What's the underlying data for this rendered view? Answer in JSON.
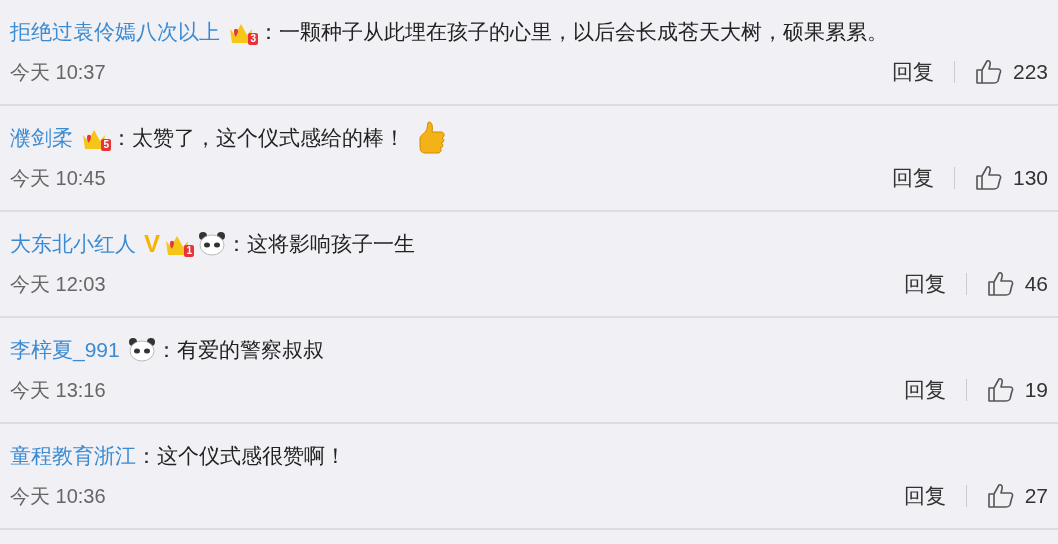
{
  "comments": [
    {
      "user": "拒绝过袁伶嫣八次以上",
      "badges": [
        {
          "kind": "crown",
          "label": "3"
        }
      ],
      "text": "：一颗种子从此埋在孩子的心里，以后会长成苍天大树，硕果累累。",
      "time": "今天 10:37",
      "reply": "回复",
      "likes": "223"
    },
    {
      "user": "濮剑柔",
      "badges": [
        {
          "kind": "crown",
          "label": "5"
        }
      ],
      "text": "：太赞了，这个仪式感给的棒！",
      "emoji": {
        "kind": "thumbs-up"
      },
      "time": "今天 10:45",
      "reply": "回复",
      "likes": "130"
    },
    {
      "user": "大东北小红人",
      "badges": [
        {
          "kind": "verified",
          "label": "V"
        },
        {
          "kind": "crown",
          "label": "1"
        },
        {
          "kind": "panda"
        }
      ],
      "text": "：这将影响孩子一生",
      "time": "今天 12:03",
      "reply": "回复",
      "likes": "46"
    },
    {
      "user": "李梓夏_991",
      "badges": [
        {
          "kind": "panda"
        }
      ],
      "text": "：有爱的警察叔叔",
      "time": "今天 13:16",
      "reply": "回复",
      "likes": "19"
    },
    {
      "user": "童程教育浙江",
      "text": "：这个仪式感很赞啊！",
      "time": "今天 10:36",
      "reply": "回复",
      "likes": "27"
    }
  ]
}
